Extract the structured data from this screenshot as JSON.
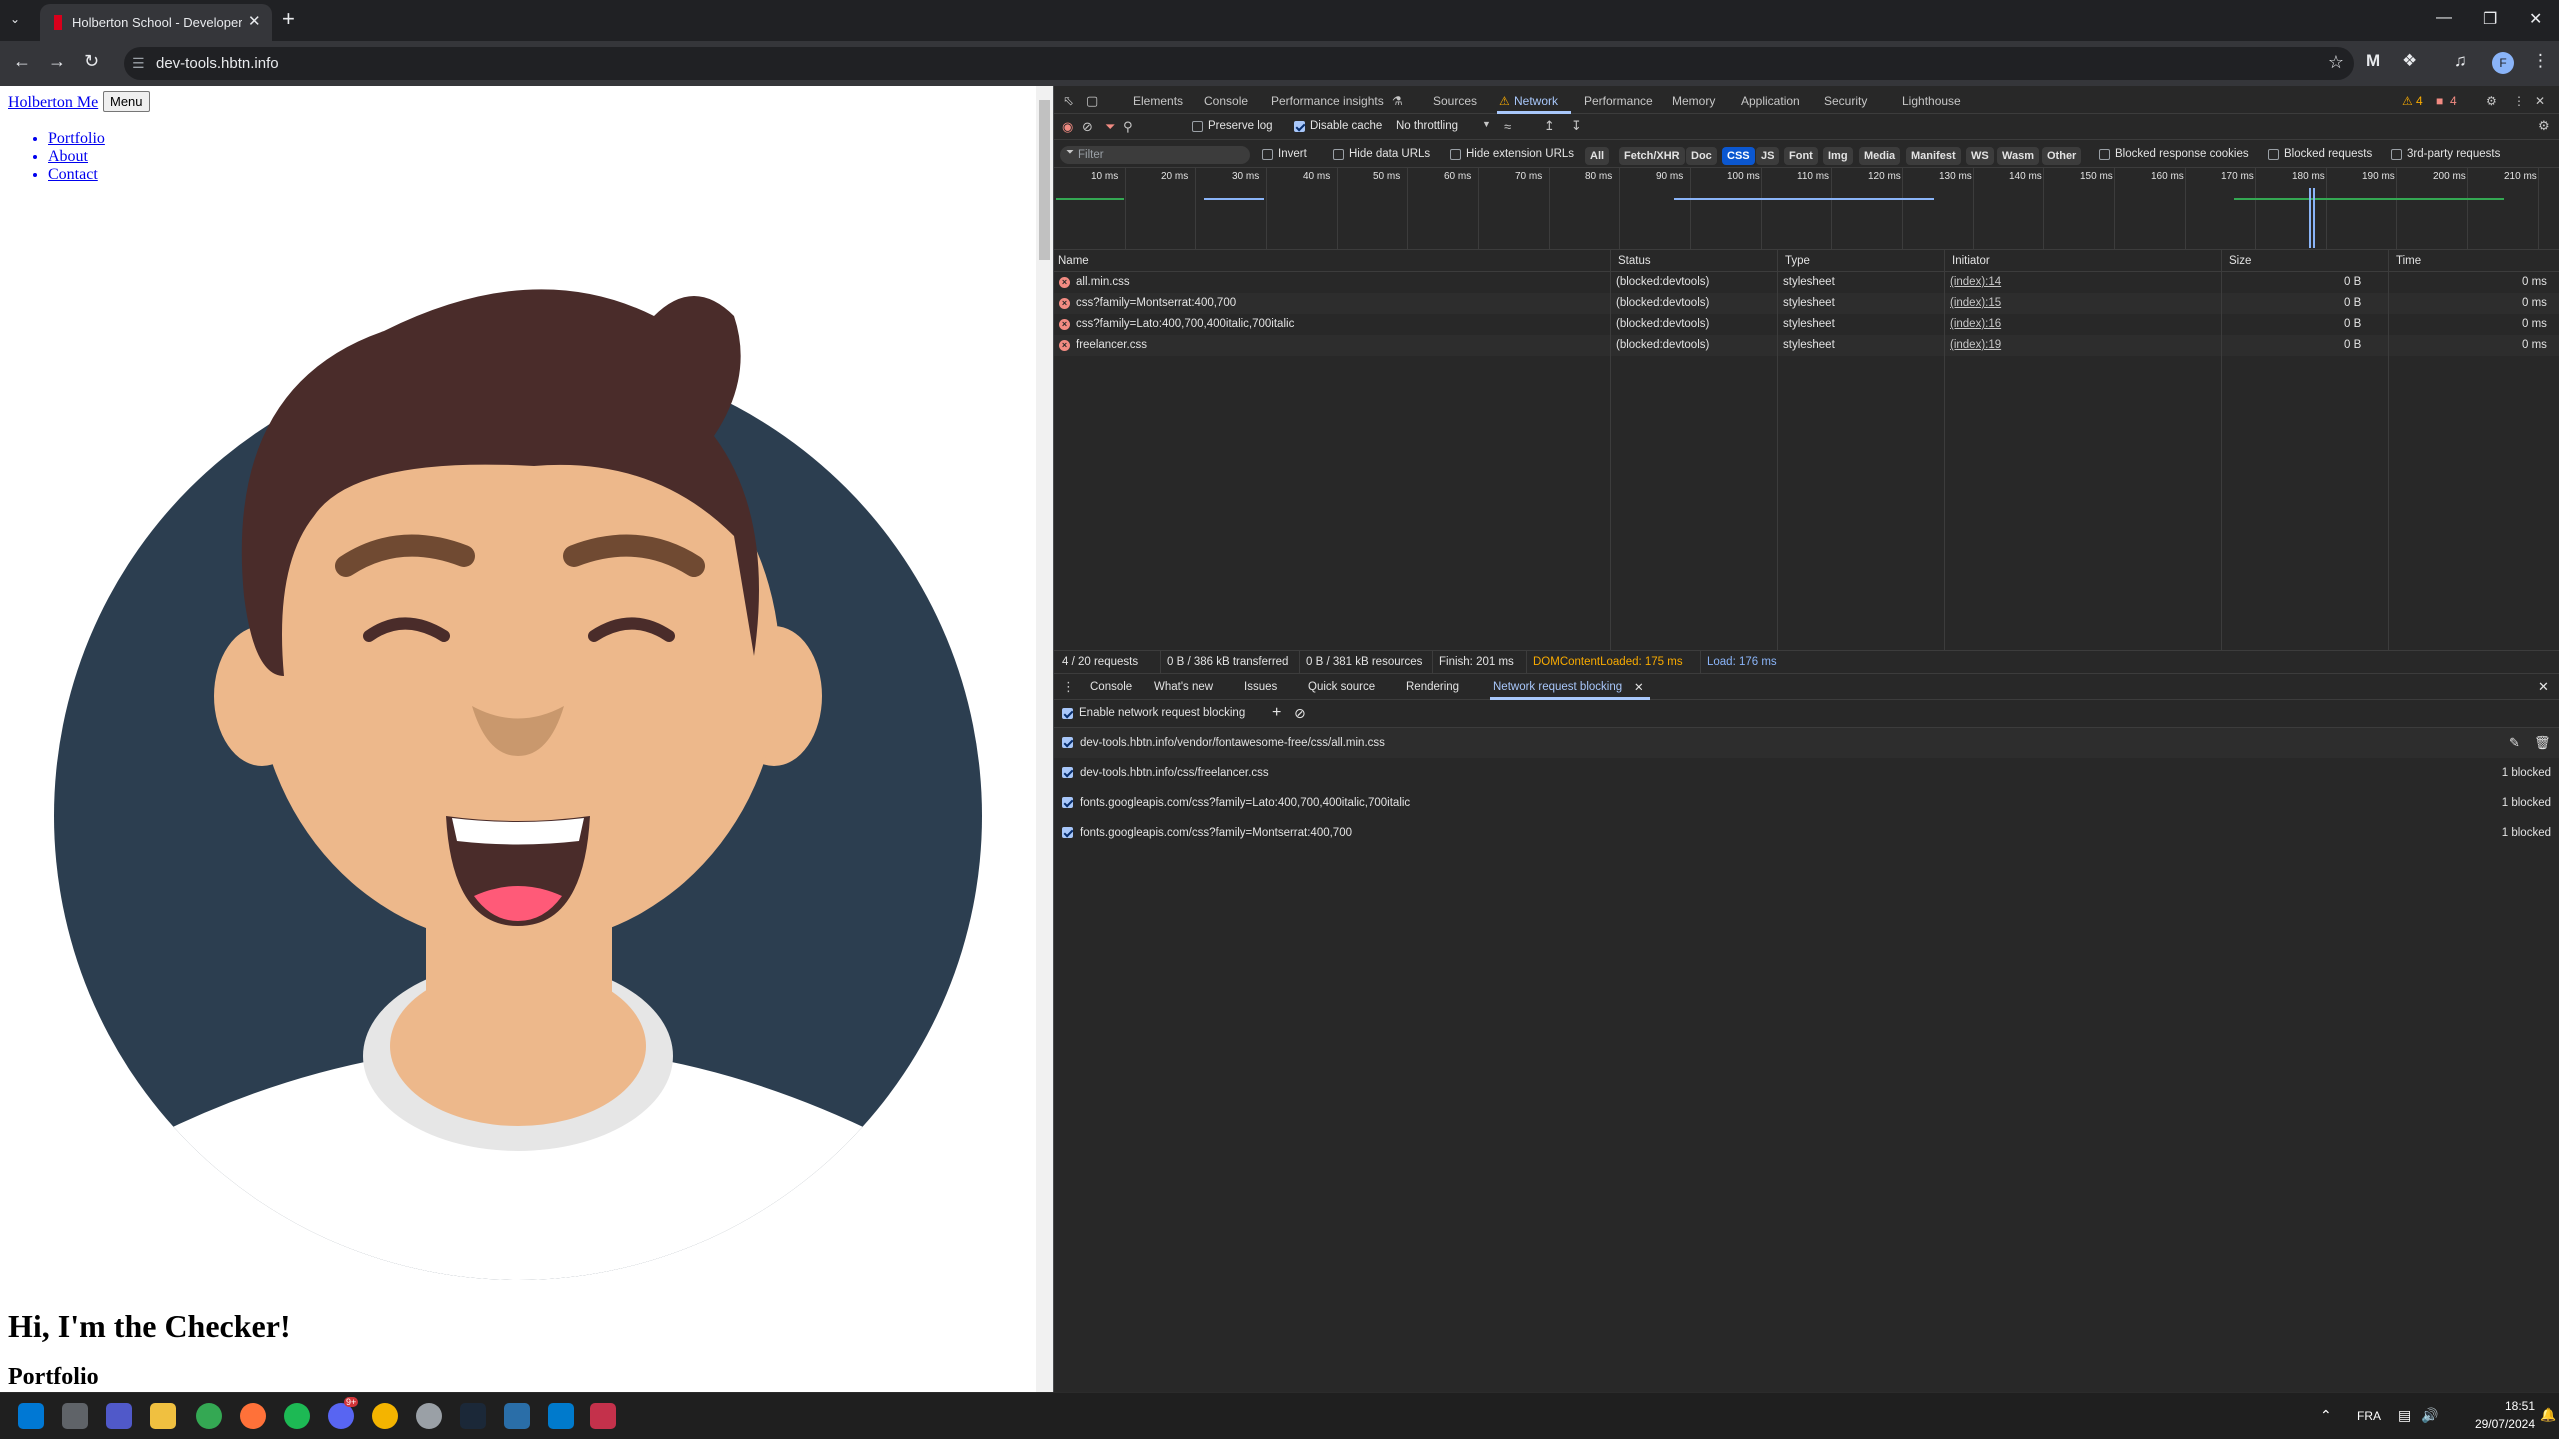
{
  "browser": {
    "tab_title": "Holberton School - Developer To",
    "url": "dev-tools.hbtn.info",
    "profile_initial": "F"
  },
  "page": {
    "brand": "Holberton Me",
    "menu_button": "Menu",
    "nav": [
      "Portfolio",
      "About",
      "Contact"
    ],
    "hero_heading": "Hi, I'm the Checker!",
    "section_heading": "Portfolio"
  },
  "devtools": {
    "tabs": [
      "Elements",
      "Console",
      "Performance insights",
      "Sources",
      "Network",
      "Performance",
      "Memory",
      "Application",
      "Security",
      "Lighthouse"
    ],
    "warnings_count": "4",
    "errors_count": "4",
    "toolbar": {
      "preserve_log": "Preserve log",
      "disable_cache": "Disable cache",
      "throttling": "No throttling"
    },
    "filter": {
      "placeholder": "Filter",
      "invert": "Invert",
      "hide_data_urls": "Hide data URLs",
      "hide_extension_urls": "Hide extension URLs",
      "types": [
        "All",
        "Fetch/XHR",
        "Doc",
        "CSS",
        "JS",
        "Font",
        "Img",
        "Media",
        "Manifest",
        "WS",
        "Wasm",
        "Other"
      ],
      "active_type": "CSS",
      "blocked_response_cookies": "Blocked response cookies",
      "blocked_requests": "Blocked requests",
      "third_party": "3rd-party requests"
    },
    "timeline_labels": [
      "10 ms",
      "20 ms",
      "30 ms",
      "40 ms",
      "50 ms",
      "60 ms",
      "70 ms",
      "80 ms",
      "90 ms",
      "100 ms",
      "110 ms",
      "120 ms",
      "130 ms",
      "140 ms",
      "150 ms",
      "160 ms",
      "170 ms",
      "180 ms",
      "190 ms",
      "200 ms",
      "210 ms"
    ],
    "columns": [
      "Name",
      "Status",
      "Type",
      "Initiator",
      "Size",
      "Time"
    ],
    "requests": [
      {
        "name": "all.min.css",
        "status": "(blocked:devtools)",
        "type": "stylesheet",
        "initiator": "(index):14",
        "size": "0 B",
        "time": "0 ms"
      },
      {
        "name": "css?family=Montserrat:400,700",
        "status": "(blocked:devtools)",
        "type": "stylesheet",
        "initiator": "(index):15",
        "size": "0 B",
        "time": "0 ms"
      },
      {
        "name": "css?family=Lato:400,700,400italic,700italic",
        "status": "(blocked:devtools)",
        "type": "stylesheet",
        "initiator": "(index):16",
        "size": "0 B",
        "time": "0 ms"
      },
      {
        "name": "freelancer.css",
        "status": "(blocked:devtools)",
        "type": "stylesheet",
        "initiator": "(index):19",
        "size": "0 B",
        "time": "0 ms"
      }
    ],
    "summary": {
      "requests": "4 / 20 requests",
      "transferred": "0 B / 386 kB transferred",
      "resources": "0 B / 381 kB resources",
      "finish": "Finish: 201 ms",
      "dom_loaded": "DOMContentLoaded: 175 ms",
      "load": "Load: 176 ms"
    },
    "drawer_tabs": [
      "Console",
      "What's new",
      "Issues",
      "Quick source",
      "Rendering",
      "Network request blocking"
    ],
    "enable_blocking": "Enable network request blocking",
    "blocked_patterns": [
      {
        "pattern": "dev-tools.hbtn.info/vendor/fontawesome-free/css/all.min.css",
        "count": ""
      },
      {
        "pattern": "dev-tools.hbtn.info/css/freelancer.css",
        "count": "1 blocked"
      },
      {
        "pattern": "fonts.googleapis.com/css?family=Lato:400,700,400italic,700italic",
        "count": "1 blocked"
      },
      {
        "pattern": "fonts.googleapis.com/css?family=Montserrat:400,700",
        "count": "1 blocked"
      }
    ],
    "colors": {
      "accent": "#a8c7fa",
      "error": "#f28b82",
      "dom_loaded": "#f9ab00",
      "load": "#8ab4f8"
    }
  },
  "taskbar": {
    "language": "FRA",
    "time": "18:51",
    "date": "29/07/2024",
    "discord_badge": "9+"
  }
}
